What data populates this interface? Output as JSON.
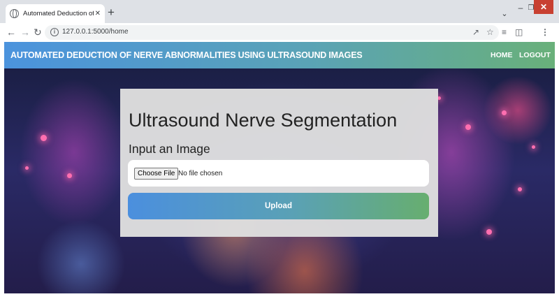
{
  "browser": {
    "tab_title": "Automated Deduction of Nerve A",
    "tab_close": "✕",
    "new_tab": "+",
    "url": "127.0.0.1:5000/home",
    "icons": [
      "globe-icon",
      "back-icon",
      "forward-icon",
      "reload-icon",
      "info-icon",
      "share-icon",
      "star-icon",
      "reading-list-icon",
      "side-panel-icon",
      "menu-icon"
    ]
  },
  "navbar": {
    "brand": "AUTOMATED DEDUCTION OF NERVE ABNORMALITIES USING ULTRASOUND IMAGES",
    "links": [
      "HOME",
      "LOGOUT"
    ],
    "gradient": [
      "#4b93dd",
      "#69b07a"
    ]
  },
  "card": {
    "title": "Ultrasound Nerve Segmentation",
    "subtitle": "Input an Image",
    "file_button": "Choose File",
    "file_status": "No file chosen",
    "upload_label": "Upload"
  }
}
